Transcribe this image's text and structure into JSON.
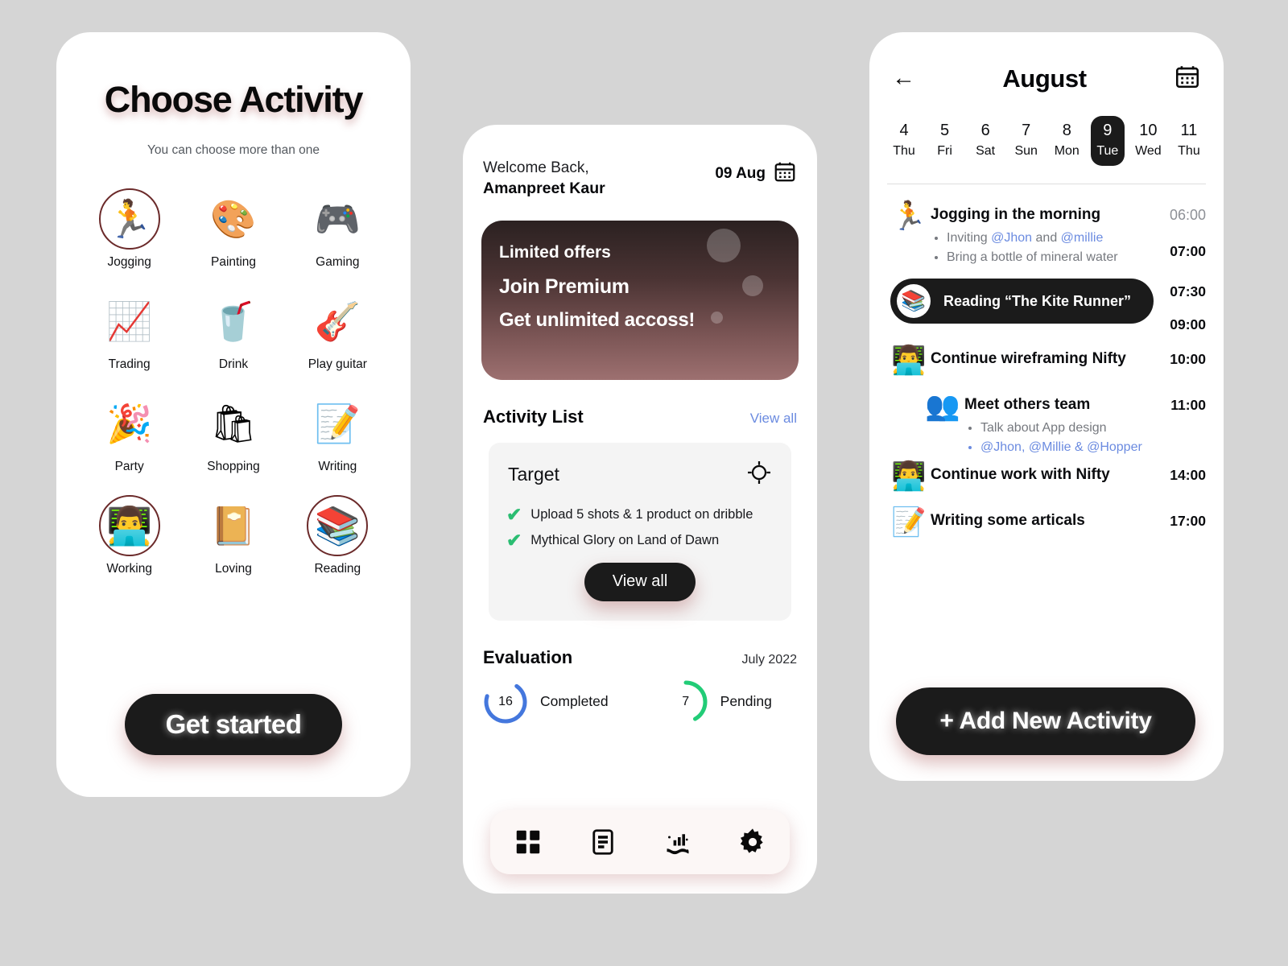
{
  "choose": {
    "title": "Choose Activity",
    "subtitle": "You can choose more than one",
    "cta": "Get started",
    "activities": [
      {
        "label": "Jogging",
        "icon": "🏃",
        "selected": true
      },
      {
        "label": "Painting",
        "icon": "🎨",
        "selected": false
      },
      {
        "label": "Gaming",
        "icon": "🎮",
        "selected": false
      },
      {
        "label": "Trading",
        "icon": "📈",
        "selected": false
      },
      {
        "label": "Drink",
        "icon": "🥤",
        "selected": false
      },
      {
        "label": "Play guitar",
        "icon": "🎸",
        "selected": false
      },
      {
        "label": "Party",
        "icon": "🎉",
        "selected": false
      },
      {
        "label": "Shopping",
        "icon": "🛍",
        "selected": false
      },
      {
        "label": "Writing",
        "icon": "📝",
        "selected": false
      },
      {
        "label": "Working",
        "icon": "👨‍💻",
        "selected": true
      },
      {
        "label": "Loving",
        "icon": "📔",
        "selected": false
      },
      {
        "label": "Reading",
        "icon": "📚",
        "selected": true
      }
    ]
  },
  "home": {
    "greeting": "Welcome Back,",
    "user_name": "Amanpreet Kaur",
    "date": "09 Aug",
    "promo": {
      "line1": "Limited offers",
      "line2": "Join Premium",
      "line3": "Get unlimited accoss!"
    },
    "activity_list": {
      "title": "Activity List",
      "link": "View all"
    },
    "target": {
      "title": "Target",
      "items": [
        "Upload 5 shots & 1 product on dribble",
        "Mythical Glory on Land of Dawn"
      ],
      "button": "View all"
    },
    "evaluation": {
      "title": "Evaluation",
      "period": "July 2022",
      "completed": {
        "value": "16",
        "label": "Completed",
        "color": "#4477dd",
        "percent": 70
      },
      "pending": {
        "value": "7",
        "label": "Pending",
        "color": "#22cc77",
        "percent": 42
      }
    },
    "nav": [
      {
        "name": "grid-icon",
        "label": "Dashboard"
      },
      {
        "name": "document-icon",
        "label": "List"
      },
      {
        "name": "chart-icon",
        "label": "Stats"
      },
      {
        "name": "gear-icon",
        "label": "Settings"
      }
    ]
  },
  "schedule": {
    "month": "August",
    "days": [
      {
        "num": "4",
        "name": "Thu",
        "active": false
      },
      {
        "num": "5",
        "name": "Fri",
        "active": false
      },
      {
        "num": "6",
        "name": "Sat",
        "active": false
      },
      {
        "num": "7",
        "name": "Sun",
        "active": false
      },
      {
        "num": "8",
        "name": "Mon",
        "active": false
      },
      {
        "num": "9",
        "name": "Tue",
        "active": true
      },
      {
        "num": "10",
        "name": "Wed",
        "active": false
      },
      {
        "num": "11",
        "name": "Thu",
        "active": false
      }
    ],
    "items": [
      {
        "icon": "🏃",
        "title": "Jogging in the morning",
        "time": "06:00",
        "time2": "07:00",
        "subs": [
          {
            "text_pre": "Inviting ",
            "mention1": "@Jhon",
            "text_mid": " and ",
            "mention2": "@millie"
          },
          {
            "text_pre": "Bring a bottle of mineral water"
          }
        ]
      },
      {
        "icon": "📚",
        "title": "Reading “The Kite Runner”",
        "time": "07:30",
        "time2": "09:00",
        "pill": true
      },
      {
        "icon": "👨‍💻",
        "title": "Continue wireframing Nifty",
        "time": "10:00"
      },
      {
        "icon": "👥",
        "title": "Meet others team",
        "time": "11:00",
        "indent": true,
        "subs": [
          {
            "text_pre": "Talk about App design"
          },
          {
            "text_pre": "@Jhon, @Millie & @Hopper",
            "blue": true
          }
        ]
      },
      {
        "icon": "👨‍💻",
        "title": "Continue work with Nifty",
        "time": "14:00"
      },
      {
        "icon": "📝",
        "title": "Writing some articals",
        "time": "17:00"
      }
    ],
    "add_button": "+ Add New Activity"
  }
}
